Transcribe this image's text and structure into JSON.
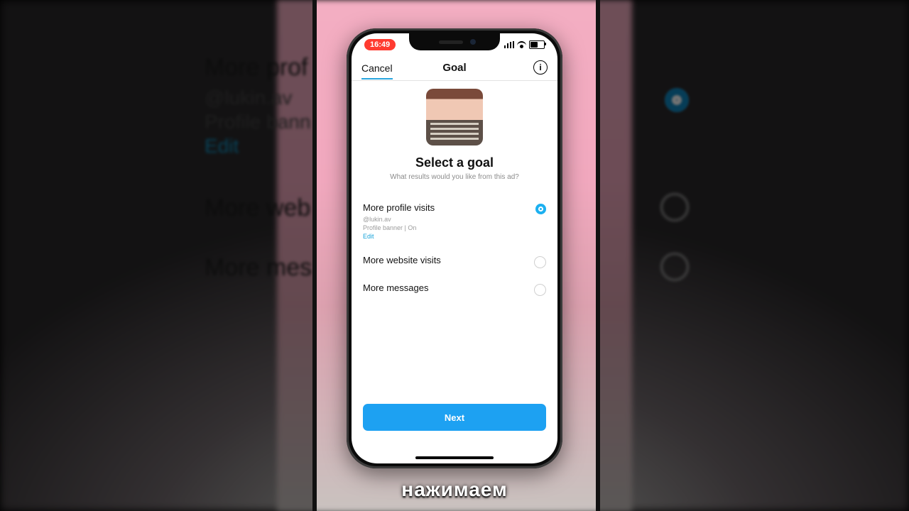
{
  "caption": "нажимаем",
  "background_left": {
    "heading1": "More prof",
    "sub1": "@lukin.av",
    "sub2": "Profile bann",
    "link": "Edit",
    "heading2": "More web",
    "heading3": "More mes"
  },
  "phone": {
    "status": {
      "time": "16:49"
    },
    "nav": {
      "cancel": "Cancel",
      "title": "Goal",
      "info_glyph": "i"
    },
    "page": {
      "title": "Select a goal",
      "subtitle": "What results would you like from this ad?"
    },
    "options": [
      {
        "label": "More profile visits",
        "meta_line1": "@lukin.av",
        "meta_line2": "Profile banner | On",
        "edit": "Edit",
        "selected": true
      },
      {
        "label": "More website visits",
        "selected": false
      },
      {
        "label": "More messages",
        "selected": false
      }
    ],
    "next_label": "Next"
  }
}
